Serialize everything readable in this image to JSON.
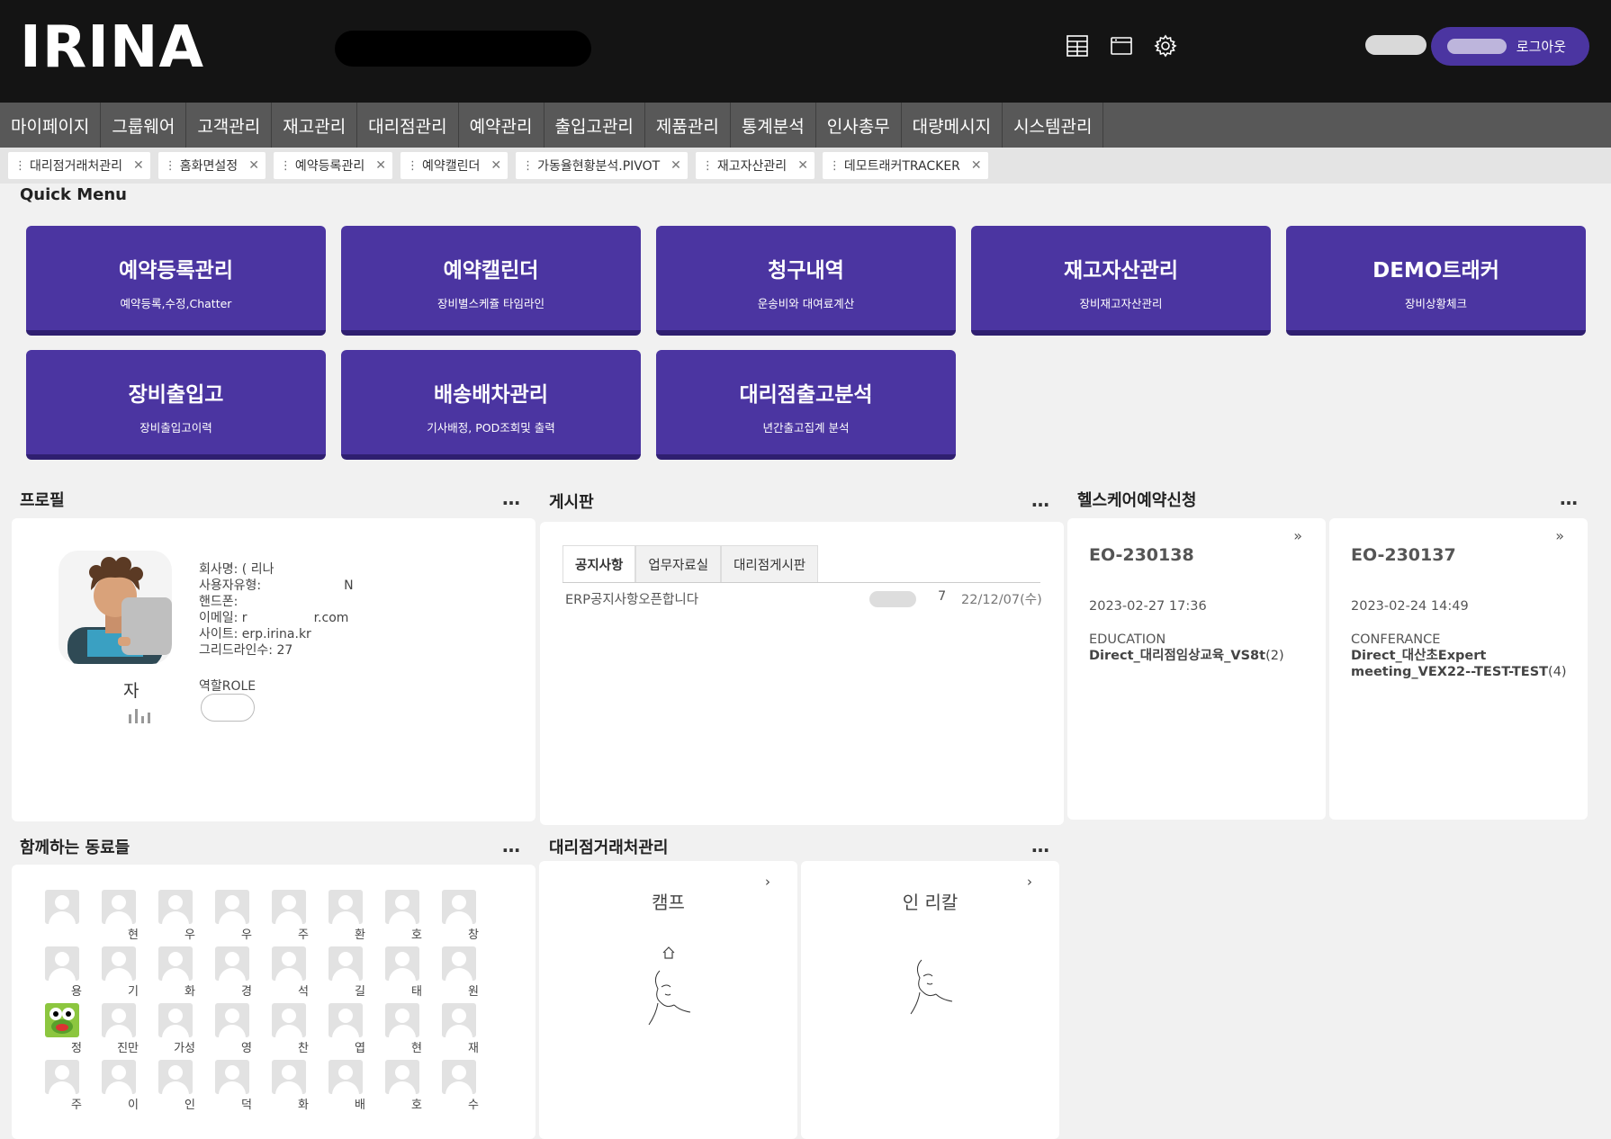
{
  "header": {
    "logo": "IRINA",
    "logout_label": "로그아웃",
    "icons": [
      "dashboard-icon",
      "window-icon",
      "gear-icon"
    ]
  },
  "nav": {
    "items": [
      "마이페이지",
      "그룹웨어",
      "고객관리",
      "재고관리",
      "대리점관리",
      "예약관리",
      "출입고관리",
      "제품관리",
      "통계분석",
      "인사총무",
      "대량메시지",
      "시스템관리"
    ]
  },
  "open_tabs": [
    "대리점거래처관리",
    "홈화면설정",
    "예약등록관리",
    "예약캘린더",
    "가동율현황분석.PIVOT",
    "재고자산관리",
    "데모트래커TRACKER"
  ],
  "quick_menu": {
    "title": "Quick Menu",
    "buttons": [
      {
        "title": "예약등록관리",
        "sub": "예약등록,수정,Chatter"
      },
      {
        "title": "예약캘린더",
        "sub": "장비별스케쥴 타임라인"
      },
      {
        "title": "청구내역",
        "sub": "운송비와 대여료계산"
      },
      {
        "title": "재고자산관리",
        "sub": "장비재고자산관리"
      },
      {
        "title": "DEMO트래커",
        "sub": "장비상황체크"
      },
      {
        "title": "장비출입고",
        "sub": "장비출입고이력"
      },
      {
        "title": "배송배차관리",
        "sub": "기사배정, POD조회및 출력"
      },
      {
        "title": "대리점출고분석",
        "sub": "년간출고집계 분석"
      }
    ]
  },
  "profile": {
    "title": "프로필",
    "company": "회사명: ( 리나",
    "user_type": "사용자유형:",
    "user_type_tail": "N",
    "phone": "핸드폰:",
    "email": "이메일: r",
    "email_tail": "r.com",
    "site": "사이트: erp.irina.kr",
    "gridline": "그리드라인수: 27",
    "role_label": "역할ROLE",
    "name_char": "자"
  },
  "board": {
    "title": "게시판",
    "tabs": [
      "공지사항",
      "업무자료실",
      "대리점게시판"
    ],
    "rows": [
      {
        "title": "ERP공지사항오픈합니다",
        "count": "7",
        "date": "22/12/07(수)"
      }
    ]
  },
  "healthcare": {
    "title": "헬스케어예약신청",
    "cards": [
      {
        "id": "EO-230138",
        "datetime": "2023-02-27 17:36",
        "category": "EDUCATION",
        "name": "Direct_대리점임상교육_VS8t",
        "count": "(2)"
      },
      {
        "id": "EO-230137",
        "datetime": "2023-02-24 14:49",
        "category": "CONFERANCE",
        "name": "Direct_대산초Expert meeting_VEX22--TEST-TEST",
        "count": "(4)"
      }
    ]
  },
  "colleagues": {
    "title": "함께하는 동료들",
    "names": [
      "",
      "현",
      "우",
      "우",
      "주",
      "환",
      "호",
      "창",
      "용",
      "기",
      "화",
      "경",
      "석",
      "길",
      "태",
      "원",
      "정",
      "진만",
      "가성",
      "영",
      "찬",
      "엽",
      "현",
      "재",
      "주",
      "이",
      "인",
      "덕",
      "화",
      "배",
      "호",
      "수"
    ]
  },
  "agency": {
    "title": "대리점거래처관리",
    "cards": [
      {
        "name": "캠프"
      },
      {
        "name": "인       리칼"
      }
    ]
  },
  "colors": {
    "accent": "#4b35a1",
    "header": "#141414",
    "nav": "#585858"
  }
}
